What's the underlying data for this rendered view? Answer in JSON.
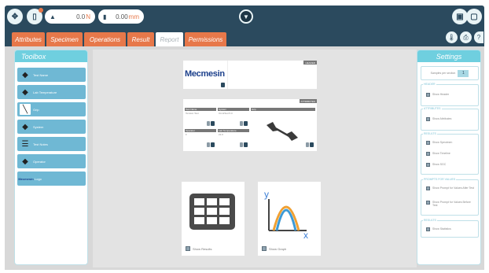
{
  "topbar": {
    "force_value": "0.0",
    "force_unit": "N",
    "position_value": "0.00",
    "position_unit": "mm"
  },
  "tabs": [
    {
      "label": "Attributes"
    },
    {
      "label": "Specimen"
    },
    {
      "label": "Operations"
    },
    {
      "label": "Result"
    },
    {
      "label": "Report"
    },
    {
      "label": "Permissions"
    }
  ],
  "toolbox": {
    "title": "Toolbox",
    "items": [
      {
        "label": "Test Name",
        "icon": "tag-icon"
      },
      {
        "label": "Lab Temperature",
        "icon": "tag-icon"
      },
      {
        "label": "Grip",
        "icon": "specimen-icon"
      },
      {
        "label": "System",
        "icon": "tag-icon"
      },
      {
        "label": "Test Notes",
        "icon": "text-lines-icon"
      },
      {
        "label": "Operator",
        "icon": "tag-icon"
      },
      {
        "label": "Logo",
        "icon": "mecmesin-logo-icon"
      }
    ]
  },
  "report": {
    "header_tag": "HEADER",
    "logo_text": "Mecmesin",
    "attributes_tag": "ATTRIBUTES",
    "attributes": [
      {
        "label": "Test Name",
        "value": "Tension Test"
      },
      {
        "label": "System",
        "value": "OmniTest 5.0"
      },
      {
        "label": "Grip",
        "value": ""
      },
      {
        "label": "Operator",
        "value": "F"
      },
      {
        "label": "Lab Temperature",
        "value": "21.0"
      }
    ],
    "results_label": "Show Results",
    "graph_label": "Show Graph",
    "graph_axis_y": "y",
    "graph_axis_x": "x"
  },
  "settings": {
    "title": "Settings",
    "samples_label": "Samples per section",
    "samples_value": "1",
    "groups": [
      {
        "title": "HEADER",
        "rows": [
          "Show Header"
        ]
      },
      {
        "title": "ATTRIBUTES",
        "rows": [
          "Show Attributes"
        ]
      },
      {
        "title": "RESULTS",
        "rows": [
          "Show Specimen",
          "Show Timeline",
          "Show SGC"
        ]
      },
      {
        "title": "PROMPTS FOR VALUES",
        "rows": [
          "Show Prompt for Values After Test",
          "Show Prompt for Values Before Test"
        ]
      },
      {
        "title": "RESULTS",
        "rows": [
          "Show Statistics"
        ]
      }
    ]
  },
  "colors": {
    "navy": "#2b4a5e",
    "orange": "#e7784a",
    "teal": "#6fcfdf",
    "toolbox_item": "#6fb8d4"
  }
}
